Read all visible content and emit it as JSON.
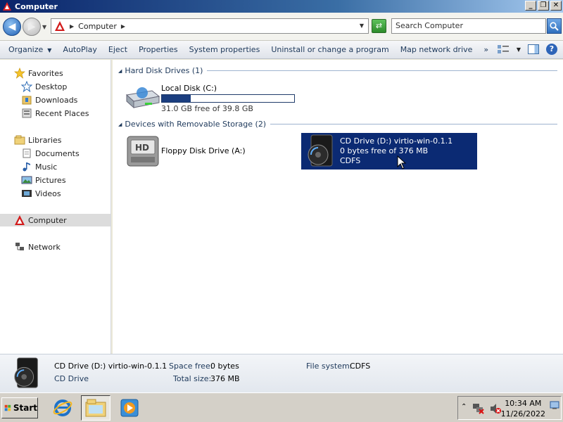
{
  "window": {
    "title": "Computer"
  },
  "address": {
    "crumb": "Computer"
  },
  "search": {
    "placeholder": "Search Computer"
  },
  "toolbar": {
    "organize": "Organize",
    "autoplay": "AutoPlay",
    "eject": "Eject",
    "properties": "Properties",
    "system_properties": "System properties",
    "uninstall": "Uninstall or change a program",
    "map_network": "Map network drive",
    "more": "»"
  },
  "nav": {
    "favorites": "Favorites",
    "desktop": "Desktop",
    "downloads": "Downloads",
    "recent": "Recent Places",
    "libraries": "Libraries",
    "documents": "Documents",
    "music": "Music",
    "pictures": "Pictures",
    "videos": "Videos",
    "computer": "Computer",
    "network": "Network"
  },
  "groups": {
    "hdd": "Hard Disk Drives (1)",
    "removable": "Devices with Removable Storage (2)"
  },
  "drives": {
    "c": {
      "name": "Local Disk (C:)",
      "free_text": "31.0 GB free of 39.8 GB",
      "used_fraction": 0.22
    },
    "a": {
      "name": "Floppy Disk Drive (A:)"
    },
    "d": {
      "name": "CD Drive (D:) virtio-win-0.1.1",
      "free_text": "0 bytes free of 376 MB",
      "fs": "CDFS"
    }
  },
  "details": {
    "name": "CD Drive (D:) virtio-win-0.1.1",
    "type": "CD Drive",
    "space_free_label": "Space free:",
    "space_free_value": "0 bytes",
    "total_size_label": "Total size:",
    "total_size_value": "376 MB",
    "fs_label": "File system:",
    "fs_value": "CDFS"
  },
  "taskbar": {
    "start": "Start",
    "time": "10:34 AM",
    "date": "11/26/2022"
  },
  "colors": {
    "selection": "#0b2a73",
    "usage_bar": "#1b3e7f",
    "toolbar_text": "#1e395b"
  }
}
